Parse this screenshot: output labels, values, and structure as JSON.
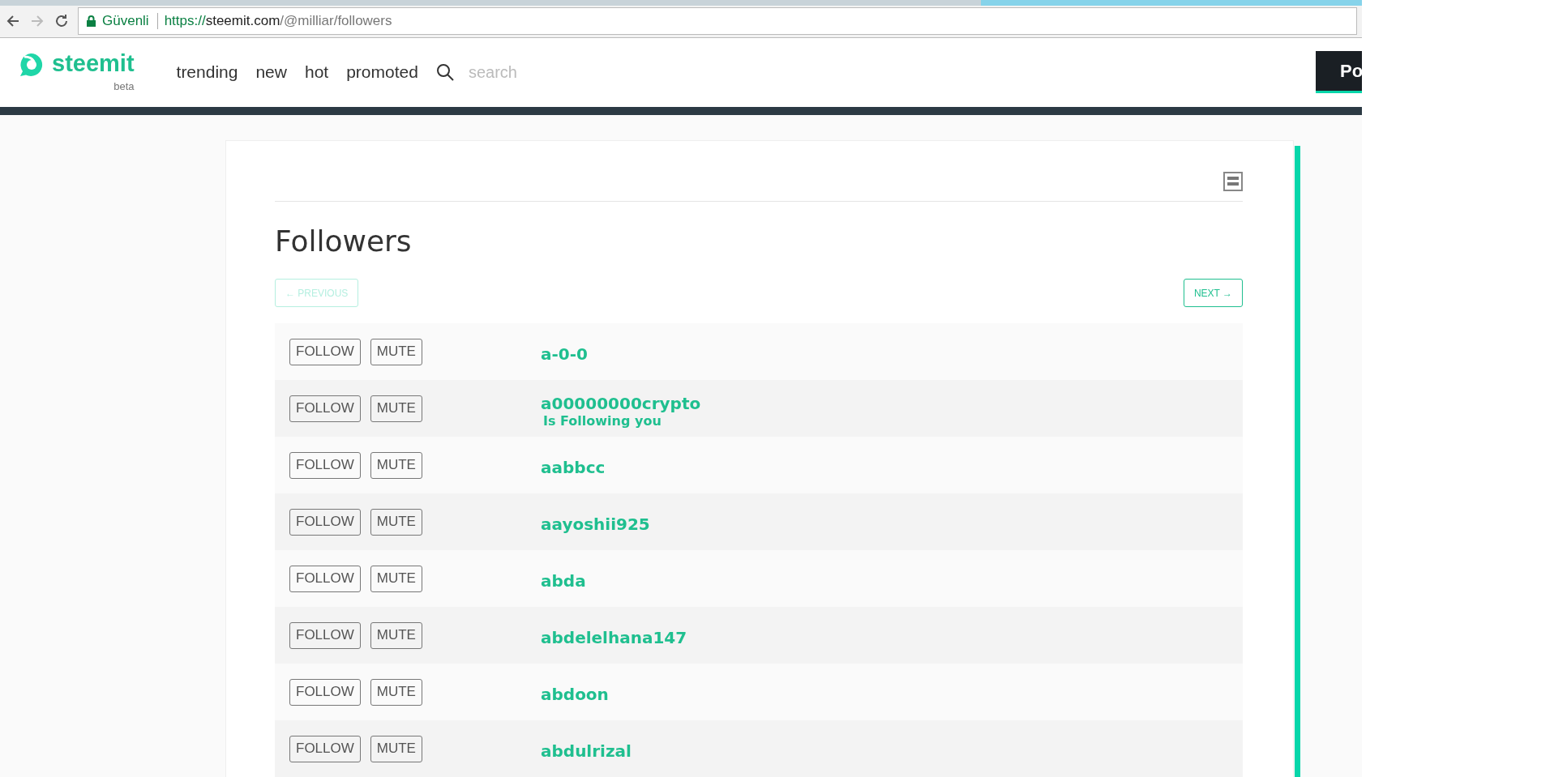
{
  "browser": {
    "secure_label": "Güvenli",
    "url_scheme": "https://",
    "url_host": "steemit.com",
    "url_path": "/@milliar/followers"
  },
  "header": {
    "logo": "steemit",
    "logo_sub": "beta",
    "nav": [
      "trending",
      "new",
      "hot",
      "promoted"
    ],
    "search": {
      "placeholder": "search"
    },
    "post_button": "Po"
  },
  "page": {
    "title": "Followers",
    "previous": {
      "label": "← PREVIOUS",
      "disabled": true
    },
    "next": {
      "label": "NEXT →",
      "disabled": false
    }
  },
  "followers": [
    {
      "name": "a-0-0",
      "follow": "FOLLOW",
      "mute": "MUTE"
    },
    {
      "name": "a00000000crypto",
      "status": "Is Following you",
      "follow": "FOLLOW",
      "mute": "MUTE"
    },
    {
      "name": "aabbcc",
      "follow": "FOLLOW",
      "mute": "MUTE"
    },
    {
      "name": "aayoshii925",
      "follow": "FOLLOW",
      "mute": "MUTE"
    },
    {
      "name": "abda",
      "follow": "FOLLOW",
      "mute": "MUTE"
    },
    {
      "name": "abdelelhana147",
      "follow": "FOLLOW",
      "mute": "MUTE"
    },
    {
      "name": "abdoon",
      "follow": "FOLLOW",
      "mute": "MUTE"
    },
    {
      "name": "abdulrizal",
      "follow": "FOLLOW",
      "mute": "MUTE"
    }
  ]
}
